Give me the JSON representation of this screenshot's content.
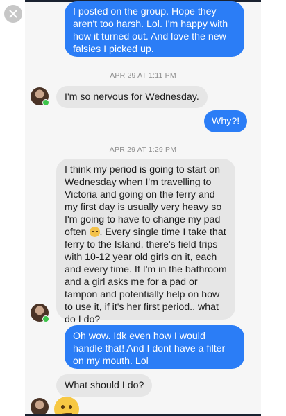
{
  "header": {
    "close_icon": "close-icon"
  },
  "messages": {
    "m1": "I posted on the group. Hope they aren't too harsh. Lol. I'm happy with how it turned out. And love the new falsies I picked up.",
    "ts1": "APR 29 AT 1:11 PM",
    "m2": "I'm so nervous for Wednesday.",
    "m3": "Why?!",
    "ts2": "APR 29 AT 1:29 PM",
    "m4_part1": "I think my period is going to start on Wednesday when I'm travelling to Victoria and going on the ferry and my first day is usually very heavy so I'm going to have to change my pad often ",
    "m4_part2": ". Every single time I take that ferry to the Island, there's field trips with 10-12 year old girls on it, each and every time. If I'm in the bathroom and a girl asks me for a pad or tampon and potentially help on how to use it, if it's her first period.. what do I do?",
    "m5": "Oh wow. Idk even how I would handle that! And I dont have a filter on my mouth. Lol",
    "m6": "What should I do?"
  },
  "colors": {
    "sent_bubble": "#2b7df6",
    "received_bubble": "#e6e6e6",
    "online": "#3cc44a"
  }
}
